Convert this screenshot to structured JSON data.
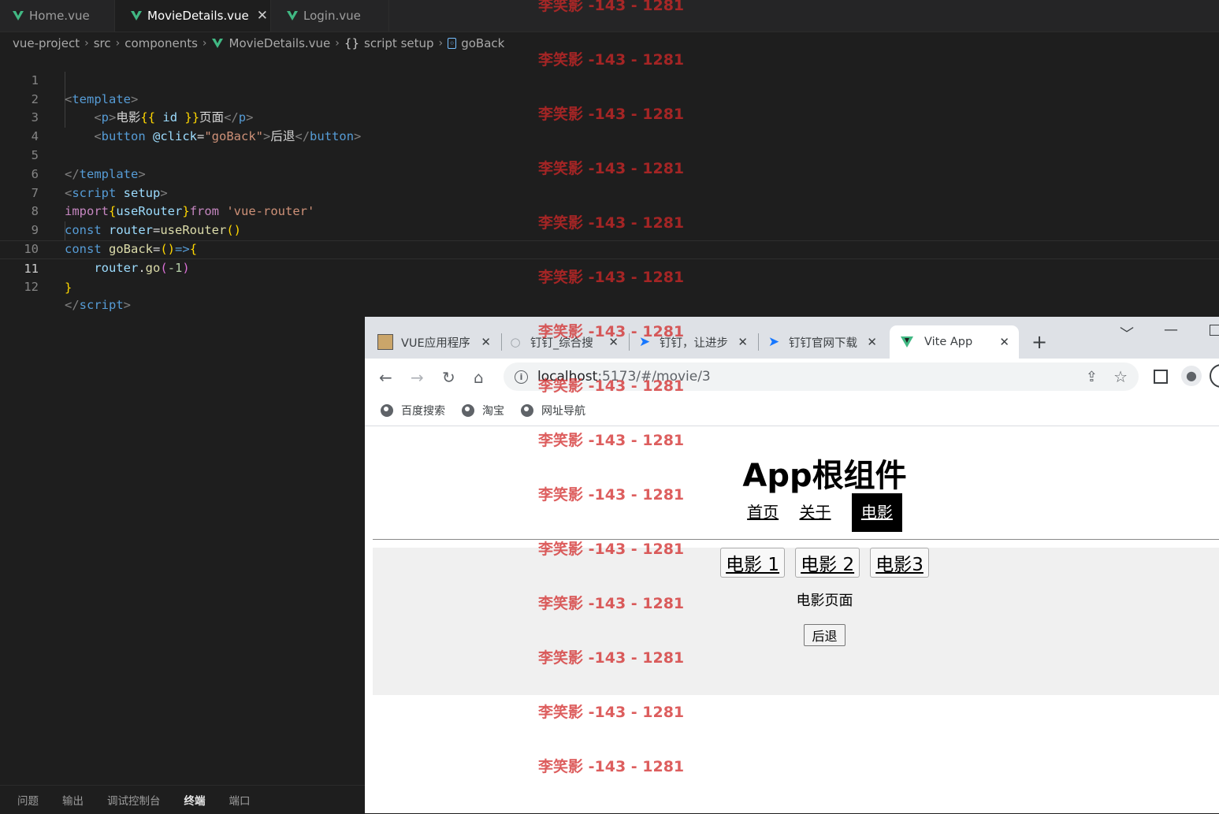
{
  "editor": {
    "tabs": [
      {
        "label": "Home.vue"
      },
      {
        "label": "MovieDetails.vue"
      },
      {
        "label": "Login.vue"
      }
    ],
    "breadcrumb": [
      "vue-project",
      "src",
      "components",
      "MovieDetails.vue",
      "script setup",
      "goBack"
    ],
    "line_numbers": [
      "1",
      "2",
      "3",
      "4",
      "5",
      "6",
      "7",
      "8",
      "9",
      "10",
      "11",
      "12"
    ],
    "code": {
      "l1": {
        "open": "<",
        "tag": "template",
        "close": ">"
      },
      "l2": {
        "p_open": "<",
        "p": "p",
        "p_gt": ">",
        "txt1": "电影",
        "mus1": "{{",
        "id": " id ",
        "mus2": "}}",
        "txt2": "页面",
        "end_lt": "</",
        "p2": "p",
        "end_gt": ">"
      },
      "l3": {
        "lt": "<",
        "tag": "button",
        "attr": " @click",
        "eq": "=",
        "str": "\"goBack\"",
        "gt": ">",
        "txt": "后退",
        "end_lt": "</",
        "tag2": "button",
        "end_gt": ">"
      },
      "l5": {
        "lt": "</",
        "tag": "template",
        "gt": ">"
      },
      "l6": {
        "lt": "<",
        "tag": "script",
        "attr": " setup",
        "gt": ">"
      },
      "l7": {
        "kw": "import",
        "b1": "{",
        "name": "useRouter",
        "b2": "}",
        "kw2": "from",
        "str": " 'vue-router'"
      },
      "l8": {
        "kw": "const",
        "var": " router",
        "eq": "=",
        "fn": "useRouter",
        "paren": "()"
      },
      "l9": {
        "kw": "const",
        "var": " goBack",
        "eq": "=",
        "p": "()",
        "arrow": "=>",
        "b": "{"
      },
      "l10": {
        "var": "router",
        "dot": ".",
        "fn": "go",
        "p1": "(",
        "num": "-1",
        "p2": ")"
      },
      "l11": {
        "b": "}"
      },
      "l12": {
        "lt": "</",
        "tag": "script",
        "gt": ">"
      }
    },
    "panel_tabs": [
      "问题",
      "输出",
      "调试控制台",
      "终端",
      "端口"
    ]
  },
  "browser": {
    "tabs": [
      {
        "label": "VUE应用程序"
      },
      {
        "label": "钉钉_综合搜"
      },
      {
        "label": "钉钉，让进步"
      },
      {
        "label": "钉钉官网下载"
      },
      {
        "label": "Vite App"
      }
    ],
    "new_tab": "+",
    "url_host": "localhost",
    "url_rest": ":5173/#/movie/3",
    "bookmarks": [
      "百度搜索",
      "淘宝",
      "网址导航"
    ]
  },
  "page": {
    "title": "App根组件",
    "nav": [
      "首页",
      "关于",
      "电影"
    ],
    "sub_nav": [
      "电影 1",
      "电影 2",
      "电影3"
    ],
    "movie_text": "电影页面",
    "back_button": "后退"
  },
  "watermark": "李笑影 -143 - 1281",
  "colors": {
    "vue_green": "#41b883",
    "watermark": "#d22828"
  }
}
